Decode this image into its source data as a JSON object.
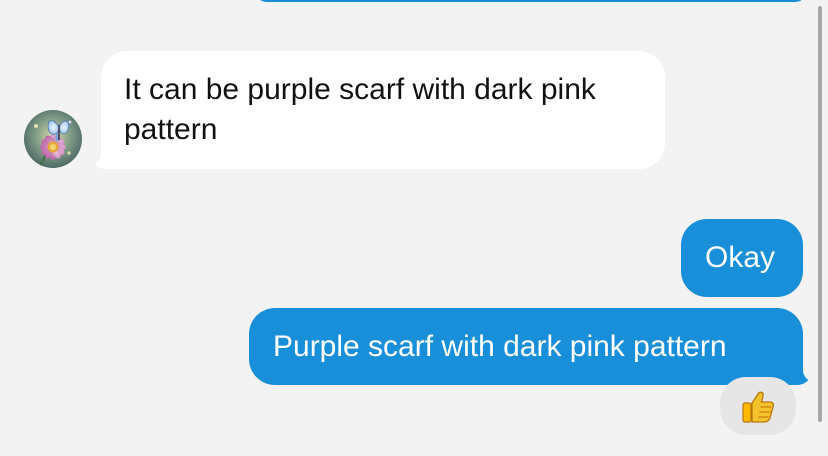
{
  "messages": [
    {
      "direction": "incoming",
      "text": "It can be purple scarf with dark pink pattern",
      "avatar_icon": "flower-butterfly-avatar"
    },
    {
      "direction": "outgoing",
      "text": "Okay"
    },
    {
      "direction": "outgoing",
      "text": "Purple scarf with dark pink pattern",
      "reaction_icon": "thumbs-up-icon"
    }
  ],
  "colors": {
    "background": "#f3f3f3",
    "incoming_bubble": "#ffffff",
    "outgoing_bubble": "#1a8fd9",
    "reaction_bubble": "#e6e6e6",
    "scrollbar": "#a7a7a7"
  }
}
